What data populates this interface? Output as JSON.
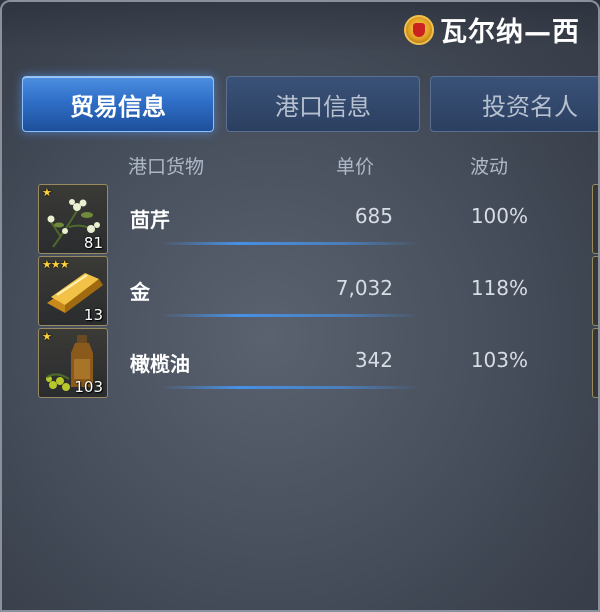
{
  "header": {
    "port_name": "瓦尔纳—西",
    "flag_icon": "port-flag-icon"
  },
  "tabs": [
    {
      "label": "贸易信息",
      "active": true
    },
    {
      "label": "港口信息",
      "active": false
    },
    {
      "label": "投资名人",
      "active": false
    }
  ],
  "table": {
    "columns": [
      "港口货物",
      "单价",
      "波动"
    ],
    "rows": [
      {
        "name": "茴芹",
        "price": "685",
        "change": "100%",
        "qty": "81",
        "stars": "★",
        "icon": "anise-herb-icon"
      },
      {
        "name": "金",
        "price": "7,032",
        "change": "118%",
        "qty": "13",
        "stars": "★★★",
        "icon": "gold-bar-icon"
      },
      {
        "name": "橄榄油",
        "price": "342",
        "change": "103%",
        "qty": "103",
        "stars": "★",
        "icon": "olive-oil-icon"
      }
    ]
  },
  "colors": {
    "accent_tab": "#2f6fc8",
    "star": "#ffd23a",
    "slot_border": "#9a8a60"
  }
}
